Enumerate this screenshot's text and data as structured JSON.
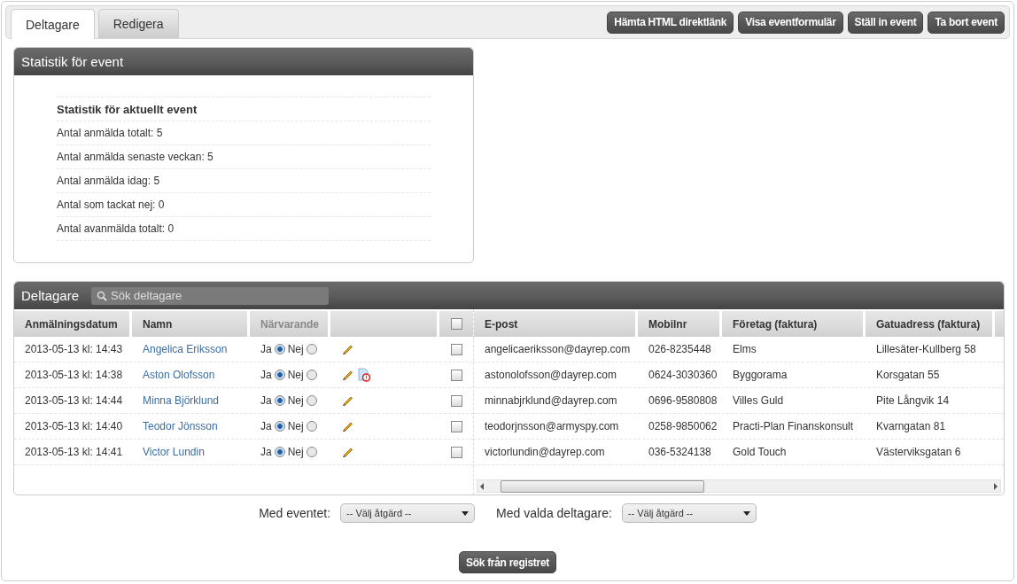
{
  "tabs": [
    {
      "label": "Deltagare",
      "selected": true
    },
    {
      "label": "Redigera",
      "selected": false
    }
  ],
  "toolbar_buttons": [
    "Hämta HTML direktlänk",
    "Visa eventformulär",
    "Ställ in event",
    "Ta bort event"
  ],
  "stats_panel": {
    "title": "Statistik för event",
    "heading": "Statistik för aktuellt event",
    "lines": [
      "Antal anmälda totalt: 5",
      "Antal anmälda senaste veckan: 5",
      "Antal anmälda idag: 5",
      "Antal som tackat nej: 0",
      "Antal avanmälda totalt: 0"
    ]
  },
  "participants_panel": {
    "title": "Deltagare",
    "search": {
      "placeholder": "Sök deltagare"
    },
    "left_columns": [
      "Anmälningsdatum",
      "Namn",
      "Närvarande"
    ],
    "right_columns": [
      "E-post",
      "Mobilnr",
      "Företag (faktura)",
      "Gatuadress (faktura)"
    ],
    "select_all_checked": false,
    "rows": [
      {
        "date": "2013-05-13 kl: 14:43",
        "name": "Angelica Eriksson",
        "yes_label": "Ja",
        "no_label": "Nej",
        "present": true,
        "alert": false,
        "checked": false,
        "email": "angelicaeriksson@dayrep.com",
        "mobile": "026-8235448",
        "company": "Elms",
        "street": "Lillesäter-Kullberg 58"
      },
      {
        "date": "2013-05-13 kl: 14:38",
        "name": "Aston Olofsson",
        "yes_label": "Ja",
        "no_label": "Nej",
        "present": true,
        "alert": true,
        "checked": false,
        "email": "astonolofsson@dayrep.com",
        "mobile": "0624-3030360",
        "company": "Byggorama",
        "street": "Korsgatan 55"
      },
      {
        "date": "2013-05-13 kl: 14:44",
        "name": "Minna Björklund",
        "yes_label": "Ja",
        "no_label": "Nej",
        "present": true,
        "alert": false,
        "checked": false,
        "email": "minnabjrklund@dayrep.com",
        "mobile": "0696-9580808",
        "company": "Villes Guld",
        "street": "Pite Långvik 14"
      },
      {
        "date": "2013-05-13 kl: 14:40",
        "name": "Teodor Jönsson",
        "yes_label": "Ja",
        "no_label": "Nej",
        "present": true,
        "alert": false,
        "checked": false,
        "email": "teodorjnsson@armyspy.com",
        "mobile": "0258-9850062",
        "company": "Practi-Plan Finanskonsult",
        "street": "Kvarngatan 81"
      },
      {
        "date": "2013-05-13 kl: 14:41",
        "name": "Victor Lundin",
        "yes_label": "Ja",
        "no_label": "Nej",
        "present": true,
        "alert": false,
        "checked": false,
        "email": "victorlundin@dayrep.com",
        "mobile": "036-5324138",
        "company": "Gold Touch",
        "street": "Västerviksgatan 6"
      }
    ]
  },
  "actions": [
    {
      "label": "Med eventet:",
      "value": "-- Välj åtgärd --"
    },
    {
      "label": "Med valda deltagare:",
      "value": "-- Välj åtgärd --"
    }
  ],
  "search_registry_button": "Sök från registret"
}
